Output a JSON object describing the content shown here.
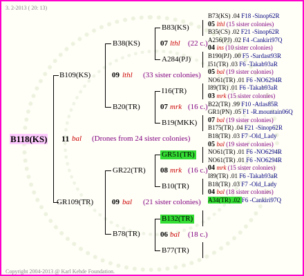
{
  "header": {
    "date": "3. 2-2013 ( 20: 13)"
  },
  "root": {
    "name": "B118(KS)",
    "gen": "11",
    "race": "bal",
    "sisters": "(Drones from 24 sister colonies)"
  },
  "nodes": {
    "b109": {
      "name": "B109(KS)",
      "gen": "09",
      "race": "lthl",
      "sisters": "(33 sister colonies)"
    },
    "gr109": {
      "name": "GR109(TR)",
      "gen": "09",
      "race": "bal",
      "sisters": "(21 sister colonies)"
    },
    "b38": "B38(KS)",
    "b20": "B20(TR)",
    "gr22": "GR22(TR)",
    "b78": "B78(TR)",
    "b83": {
      "name": "B83(KS)",
      "gen": "07",
      "race": "lthl",
      "sisters": "(22 c.)"
    },
    "a284": "A284(PJ)",
    "i16": {
      "name": "I16(TR)",
      "gen": "07",
      "race": "mrk",
      "sisters": "(16 c.)"
    },
    "b19": "B19(MKK)",
    "gr51": {
      "name": "GR51(TR)",
      "gen": "08",
      "race": "mrk",
      "sisters": "(16 c.)"
    },
    "b10": "B10(TR)",
    "b132": {
      "name": "B132(TR)",
      "gen": "06",
      "race": "bal",
      "sisters": "(18 c.)"
    },
    "b77": "B77(TR)"
  },
  "level4": [
    {
      "type": "q",
      "name": "B73(KS)",
      "val": ".04",
      "code": "F18 -Sinop62R"
    },
    {
      "type": "g",
      "gen": "05",
      "race": "lthl",
      "sisters": "(15 sister colonies)"
    },
    {
      "type": "q",
      "name": "B35(CS)",
      "val": ".02",
      "code": "F21 -Sinop62R"
    },
    {
      "type": "q",
      "name": "A256(PJ)",
      "val": ".02",
      "code": "F4 -Cankiri97Q"
    },
    {
      "type": "g",
      "gen": "04",
      "race": "ins",
      "sisters": "(10 sister colonies)"
    },
    {
      "type": "q",
      "name": "B190(PJ)",
      "val": ".00",
      "code": "F5 -Sardast93R"
    },
    {
      "type": "q",
      "name": "I51(TR)",
      "val": ".03",
      "code": "F6 -Takab93aR"
    },
    {
      "type": "g",
      "gen": "05",
      "race": "bal",
      "sisters": "(19 sister colonies)"
    },
    {
      "type": "q",
      "name": "NO61(TR)",
      "val": ".01",
      "code": "F6 -NO6294R"
    },
    {
      "type": "q",
      "name": "I89(TR)",
      "val": ".01",
      "code": "F6 -Takab93aR"
    },
    {
      "type": "g",
      "gen": "03",
      "race": "mrk",
      "sisters": "(15 sister colonies)"
    },
    {
      "type": "q",
      "name": "B22(TR)",
      "val": ".99",
      "code": "F10 -Atlas85R"
    },
    {
      "type": "q",
      "name": "GR1(PN)",
      "val": ".05",
      "code": "F1 -R.mountain06Q"
    },
    {
      "type": "g",
      "gen": "07",
      "race": "bal",
      "sisters": "(19 sister colonies)"
    },
    {
      "type": "q",
      "name": "B175(TR)",
      "val": ".04",
      "code": "F21 -Sinop62R"
    },
    {
      "type": "q",
      "name": "B18(TR)",
      "val": ".03",
      "code": "F7 -Old_Lady"
    },
    {
      "type": "g",
      "gen": "05",
      "race": "bal",
      "sisters": "(19 sister colonies)"
    },
    {
      "type": "q",
      "name": "NO61(TR)",
      "val": ".01",
      "code": "F6 -NO6294R"
    },
    {
      "type": "q",
      "name": "NO61(TR)",
      "val": ".01",
      "code": "F6 -NO6294R"
    },
    {
      "type": "g",
      "gen": "04",
      "race": "mrk",
      "sisters": "(15 sister colonies)"
    },
    {
      "type": "q",
      "name": "I89(TR)",
      "val": ".01",
      "code": "F6 -Takab93aR"
    },
    {
      "type": "q",
      "name": "B18(TR)",
      "val": ".03",
      "code": "F7 -Old_Lady"
    },
    {
      "type": "g",
      "gen": "04",
      "race": "bal",
      "sisters": "(18 sister colonies)"
    },
    {
      "type": "q",
      "name": "A34(TR)",
      "val": ".02",
      "code": "F6 -Cankiri97Q",
      "highlight": true
    }
  ],
  "footer": {
    "copyright": "Copyright 2004-2013 @ Karl Kehde Foundation."
  },
  "colors": {
    "border": "#ff00cc",
    "root_highlight": "#ffccff",
    "node_highlight": "#33dd33",
    "race": "#cc0000",
    "sisters": "#800080",
    "code": "#000080"
  }
}
